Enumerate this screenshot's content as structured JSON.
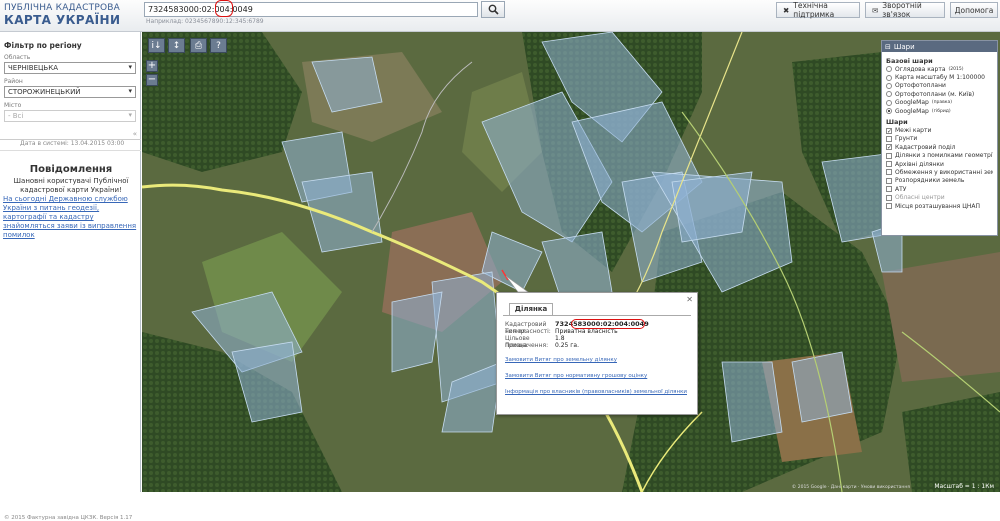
{
  "header": {
    "logo_line1": "ПУБЛІЧНА КАДАСТРОВА",
    "logo_line2": "КАРТА УКРАЇНИ",
    "search_value": "7324583000:02:004:0049",
    "search_hint": "Наприклад: 0234567890:12:345:6789",
    "buttons": [
      {
        "label": "Технічна підтримка",
        "icon": "wrench-icon"
      },
      {
        "label": "Зворотній зв'язок",
        "icon": "envelope-icon"
      },
      {
        "label": "Допомога",
        "icon": ""
      }
    ]
  },
  "sidebar": {
    "filter_title": "Фільтр по регіону",
    "oblast_label": "Область",
    "oblast_value": "ЧЕРНІВЕЦЬКА",
    "rayon_label": "Район",
    "rayon_value": "СТОРОЖИНЕЦЬКИЙ",
    "city_label": "Місто",
    "city_value": "- Всі",
    "data_date": "Дата в системі: 13.04.2015 03:00",
    "notice_title": "Повідомлення",
    "notice_text": "Шановні користувачі Публічної кадастрової карти України!",
    "notice_link": "На сьогодні Державною службою України з питань геодезії, картографії та кадастру знайомляться заяви із виправлення помилок",
    "footer": "© 2015 Фактурна завідна ЦКЗК. Версія 1.17"
  },
  "map_tools": [
    {
      "icon": "identify-icon",
      "glyph": "i↓"
    },
    {
      "icon": "measure-icon",
      "glyph": "↕"
    },
    {
      "icon": "print-icon",
      "glyph": "⎙"
    },
    {
      "icon": "help-icon",
      "glyph": "?"
    }
  ],
  "zoom": {
    "in": "+",
    "out": "−"
  },
  "layers": {
    "title": "Шари",
    "base_title": "Базові шари",
    "base": [
      {
        "label": "Оглядова карта",
        "sup": "(2015)",
        "selected": false
      },
      {
        "label": "Карта масштабу М 1:100000",
        "sup": "",
        "selected": false
      },
      {
        "label": "Ортофотоплани",
        "sup": "",
        "selected": false
      },
      {
        "label": "Ортофотоплани (м. Київ)",
        "sup": "",
        "selected": false
      },
      {
        "label": "GoogleMap",
        "sup": "(правка)",
        "selected": false
      },
      {
        "label": "GoogleMap",
        "sup": "(гібрид)",
        "selected": true
      }
    ],
    "overlay_title": "Шари",
    "overlays": [
      {
        "label": "Межі карти",
        "checked": true,
        "dim": false
      },
      {
        "label": "Ґрунти",
        "checked": false,
        "dim": false
      },
      {
        "label": "Кадастровий поділ",
        "checked": true,
        "dim": false
      },
      {
        "label": "Ділянки з помилками геометрії",
        "checked": false,
        "dim": false
      },
      {
        "label": "Архівні ділянки",
        "checked": false,
        "dim": false
      },
      {
        "label": "Обмеження у використанні земель",
        "checked": false,
        "dim": false
      },
      {
        "label": "Розпорядники земель",
        "checked": false,
        "dim": false
      },
      {
        "label": "АТУ",
        "checked": false,
        "dim": false
      },
      {
        "label": "Обласні центри",
        "checked": false,
        "dim": true
      },
      {
        "label": "Місця розташування ЦНАП",
        "checked": false,
        "dim": false
      }
    ]
  },
  "popup": {
    "tab": "Ділянка",
    "rows": [
      {
        "k": "Кадастровий номер:",
        "v": "7324583000:02:004:0049"
      },
      {
        "k": "Тип власності:",
        "v": "Приватна власність"
      },
      {
        "k": "Цільове призначення:",
        "v": "1.8"
      },
      {
        "k": "Площа:",
        "v": "0.25 га."
      }
    ],
    "links": [
      "Замовити Витяг про земельну ділянку",
      "Замовити Витяг про нормативну грошову оцінку",
      "Інформація про власників (правовласників) земельної ділянки"
    ]
  },
  "map": {
    "scale": "Масштаб = 1 : 1Км",
    "attribution": "© 2015 Google · Дані карти · Умови використання"
  },
  "colors": {
    "parcel_fill": "#8fb3d6",
    "parcel_stroke": "#c6dcf0",
    "road": "#f3f08a",
    "forest": "#2f4a24",
    "field": "#6f7a4c",
    "accent_red": "#dd1111"
  }
}
